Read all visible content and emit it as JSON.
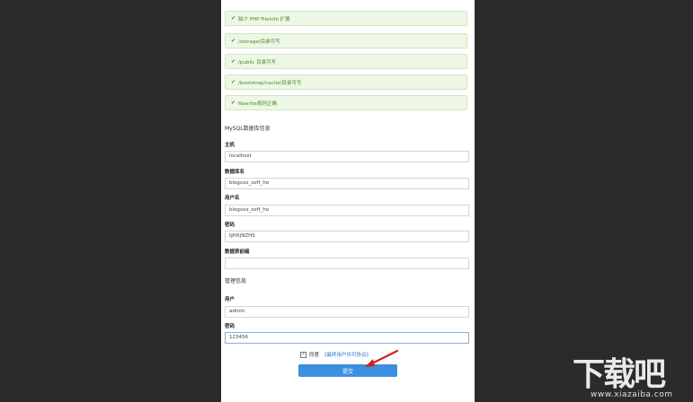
{
  "checks": [
    {
      "label": "缺少 PHP Fileinfo 扩展"
    },
    {
      "label": "/storage/目录可写"
    },
    {
      "label": "/public 目录可写"
    },
    {
      "label": "/bootstrap/cache/目录可写"
    },
    {
      "label": "Rewrite规则正确"
    }
  ],
  "mysql": {
    "title": "MySQL数据库信息",
    "host_label": "主机",
    "host_value": "localhost",
    "db_label": "数据库名",
    "db_value": "blogxxx_soft_ho",
    "user_label": "用户名",
    "user_value": "blogxxx_soft_ho",
    "pass_label": "密码",
    "pass_value": "tJHXjNZHS",
    "prefix_label": "数据表前缀",
    "prefix_value": ""
  },
  "admin": {
    "title": "管理信息",
    "user_label": "用户",
    "user_value": "admin",
    "pass_label": "密码",
    "pass_value": "123456"
  },
  "agree": {
    "prefix": "同意",
    "link": "《最终用户许可协议》"
  },
  "submit_label": "提交",
  "watermark": {
    "main": "下载吧",
    "sub": "www.xiazaiba.com"
  },
  "colors": {
    "background": "#2b2b2b",
    "success_bg": "#eef7e6",
    "success_text": "#4a8a2c",
    "primary": "#3d8fe0",
    "arrow": "#d42020"
  },
  "icons": [
    "check-icon",
    "arrow-annotation-icon"
  ]
}
